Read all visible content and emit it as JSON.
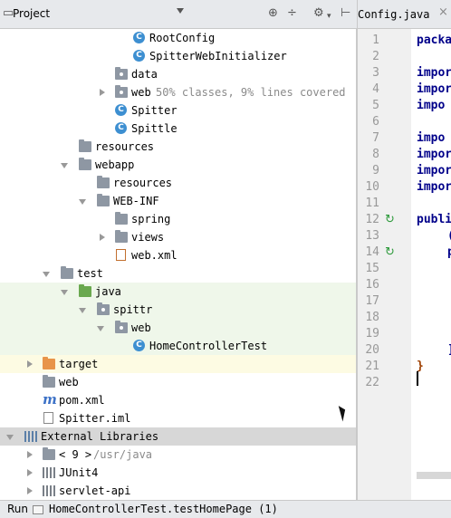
{
  "project_panel": {
    "title": "Project",
    "icons": [
      "target-icon",
      "collapse-all-icon",
      "gear-icon",
      "hide-icon"
    ]
  },
  "editor": {
    "tab_label": "Config.java",
    "line_numbers": [
      "1",
      "2",
      "3",
      "4",
      "5",
      "6",
      "7",
      "8",
      "9",
      "10",
      "11",
      "12",
      "13",
      "14",
      "15",
      "16",
      "17",
      "18",
      "19",
      "20",
      "21",
      "22"
    ],
    "code_lines": {
      "1": "packa",
      "3": "impor",
      "4": "impor",
      "5": "impo",
      "7": "impo",
      "8": "impor",
      "9": "impor",
      "10": "impor",
      "12": "publi",
      "13": "(",
      "14": "p",
      "20": "]",
      "21": "}"
    }
  },
  "tree": [
    {
      "id": "rootconfig",
      "label": "RootConfig",
      "icon": "class-icon"
    },
    {
      "id": "spitterwebinit",
      "label": "SpitterWebInitializer",
      "icon": "class-icon"
    },
    {
      "id": "data",
      "label": "data",
      "icon": "package-icon"
    },
    {
      "id": "web",
      "label": "web",
      "coverage": "50% classes, 9% lines covered",
      "icon": "package-icon"
    },
    {
      "id": "spitter",
      "label": "Spitter",
      "icon": "class-icon"
    },
    {
      "id": "spittle",
      "label": "Spittle",
      "icon": "class-icon"
    },
    {
      "id": "resources",
      "label": "resources",
      "icon": "resources-folder-icon"
    },
    {
      "id": "webapp",
      "label": "webapp",
      "icon": "folder-icon"
    },
    {
      "id": "webapp-resources",
      "label": "resources",
      "icon": "folder-icon"
    },
    {
      "id": "webinf",
      "label": "WEB-INF",
      "icon": "folder-icon"
    },
    {
      "id": "spring",
      "label": "spring",
      "icon": "folder-icon"
    },
    {
      "id": "views",
      "label": "views",
      "icon": "folder-icon"
    },
    {
      "id": "webxml",
      "label": "web.xml",
      "icon": "xml-file-icon"
    },
    {
      "id": "test",
      "label": "test",
      "icon": "folder-icon"
    },
    {
      "id": "java",
      "label": "java",
      "icon": "test-folder-icon"
    },
    {
      "id": "spittr",
      "label": "spittr",
      "icon": "package-icon"
    },
    {
      "id": "test-web",
      "label": "web",
      "icon": "package-icon"
    },
    {
      "id": "homecontrollertest",
      "label": "HomeControllerTest",
      "icon": "test-class-icon"
    },
    {
      "id": "target",
      "label": "target",
      "icon": "excluded-folder-icon"
    },
    {
      "id": "root-web",
      "label": "web",
      "icon": "folder-icon"
    },
    {
      "id": "pomxml",
      "label": "pom.xml",
      "icon": "maven-icon"
    },
    {
      "id": "spitteriml",
      "label": "Spitter.iml",
      "icon": "iml-file-icon"
    },
    {
      "id": "extlibs",
      "label": "External Libraries",
      "icon": "libraries-icon"
    },
    {
      "id": "jdk9",
      "label": "< 9 >",
      "path": "/usr/java",
      "icon": "jdk-icon"
    },
    {
      "id": "junit4",
      "label": "JUnit4",
      "icon": "library-icon"
    },
    {
      "id": "servletapi",
      "label": "servlet-api",
      "icon": "library-icon"
    }
  ],
  "status_bar": {
    "run_label": "Run",
    "run_config": "HomeControllerTest.testHomePage (1)"
  },
  "colors": {
    "test_bg": "#eff7ea",
    "target_bg": "#fdfbe3",
    "selection_bg": "#d7d7d7",
    "keyword": "#00008a",
    "class_icon": "#3d8fd1"
  }
}
